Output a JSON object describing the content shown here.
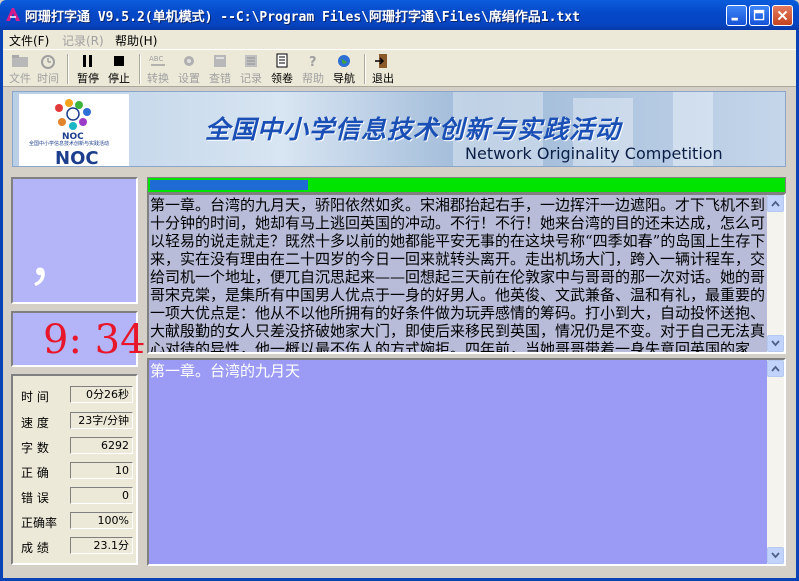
{
  "window": {
    "title": "阿珊打字通 V9.5.2(单机模式)  --C:\\Program Files\\阿珊打字通\\Files\\席绢作品1.txt"
  },
  "menu": {
    "items": [
      {
        "label": "文件(F)",
        "enabled": true
      },
      {
        "label": "记录(R)",
        "enabled": false
      },
      {
        "label": "帮助(H)",
        "enabled": true
      }
    ]
  },
  "toolbar": {
    "buttons": [
      {
        "label": "文件",
        "icon": "folder-icon",
        "enabled": false
      },
      {
        "label": "时间",
        "icon": "timer-icon",
        "enabled": false
      },
      {
        "label": "暂停",
        "icon": "pause-icon",
        "enabled": true
      },
      {
        "label": "停止",
        "icon": "stop-icon",
        "enabled": true
      },
      {
        "label": "转换",
        "icon": "abc-convert-icon",
        "enabled": false
      },
      {
        "label": "设置",
        "icon": "gear-icon",
        "enabled": false
      },
      {
        "label": "查错",
        "icon": "check-icon",
        "enabled": false
      },
      {
        "label": "记录",
        "icon": "record-icon",
        "enabled": false
      },
      {
        "label": "领卷",
        "icon": "paper-icon",
        "enabled": true
      },
      {
        "label": "帮助",
        "icon": "help-icon",
        "enabled": false
      },
      {
        "label": "导航",
        "icon": "globe-icon",
        "enabled": true
      },
      {
        "label": "退出",
        "icon": "exit-icon",
        "enabled": true
      }
    ]
  },
  "banner": {
    "logo_text": "NOC",
    "logo_small": "NOC",
    "logo_line": "全国中小学信息技术创新与实践活动",
    "title_cn": "全国中小学信息技术创新与实践活动",
    "title_en": "Network Originality Competition"
  },
  "current_char": "，",
  "clock": "9: 34",
  "stats": [
    {
      "label": "时  间",
      "value": "0分26秒"
    },
    {
      "label": "速  度",
      "value": "23字/分钟"
    },
    {
      "label": "字  数",
      "value": "6292"
    },
    {
      "label": "正  确",
      "value": "10"
    },
    {
      "label": "错  误",
      "value": "0"
    },
    {
      "label": "正确率",
      "value": "100%"
    },
    {
      "label": "成  绩",
      "value": "23.1分"
    }
  ],
  "progress": {
    "fraction": 0.25
  },
  "source_text": "第一章。台湾的九月天，骄阳依然如炙。宋湘郡抬起右手，一边挥汗一边遮阳。才下飞机不到十分钟的时间，她却有马上逃回英国的冲动。不行！不行！她来台湾的目的还未达成，怎么可以轻易的说走就走？既然十多以前的她都能平安无事的在这块号称“四季如春”的岛国上生存下来，实在没有理由在二十四岁的今日一回来就转头离开。走出机场大门，跨入一辆计程车，交给司机一个地址，便兀自沉思起来——回想起三天前在伦敦家中与哥哥的那一次对话。她的哥哥宋克棠，是集所有中国男人优点于一身的好男人。他英俊、文武兼备、温和有礼，最重要的一项大优点是：他从不以他所拥有的好条件做为玩弄感情的筹码。打小到大，自动投怀送抱、大献殷勤的女人只差没挤破她家大门，即使后来移民到英国，情况仍是不变。对于自己无法真心对待的异性，他一概以最不伤人的方式婉拒。四年前，当她哥哥带着一身失意回英国的家时，宋湘郡就发现了某些",
  "typed_text": "第一章。台湾的九月天"
}
